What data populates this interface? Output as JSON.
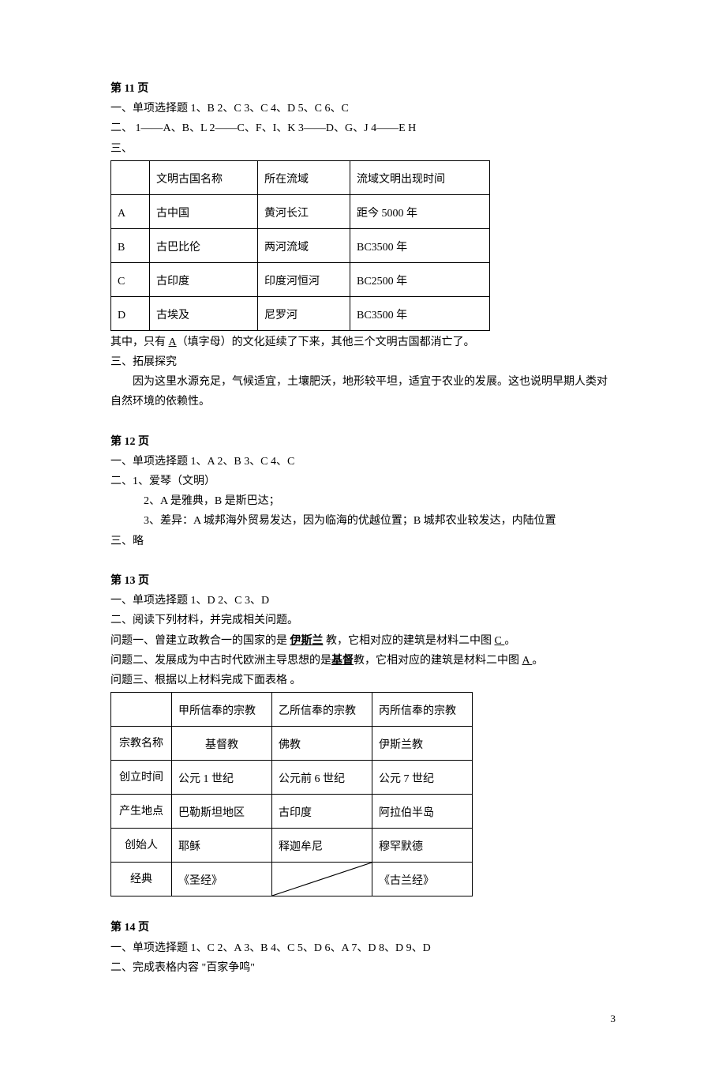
{
  "page11": {
    "heading": "第 11 页",
    "line1_prefix": "一、单项选择题",
    "mc": [
      "1、B",
      "2、C",
      "3、C",
      "4、D",
      "5、C",
      "6、C"
    ],
    "line2_prefix": "二、",
    "match": [
      "1——A、B、L",
      "2——C、F、I、K",
      "3——D、G、J",
      "4——E   H"
    ],
    "line3": "三、",
    "table_headers": [
      "",
      "文明古国名称",
      "所在流域",
      "流域文明出现时间"
    ],
    "table_rows": [
      [
        "A",
        "古中国",
        "黄河长江",
        "距今 5000 年"
      ],
      [
        "B",
        "古巴比伦",
        "两河流域",
        "BC3500 年"
      ],
      [
        "C",
        "古印度",
        "印度河恒河",
        "BC2500 年"
      ],
      [
        "D",
        "古埃及",
        "尼罗河",
        "BC3500 年"
      ]
    ],
    "after_table_1a": "其中，只有 ",
    "after_table_1_fill": "A",
    "after_table_1b": "（填字母）的文化延续了下来，其他三个文明古国都消亡了。",
    "after_table_2": "三、拓展探究",
    "after_table_3": "因为这里水源充足，气候适宜，土壤肥沃，地形较平坦，适宜于农业的发展。这也说明早期人类对自然环境的依赖性。"
  },
  "page12": {
    "heading": "第 12 页",
    "line1_prefix": "一、单项选择题",
    "mc": [
      "1、A",
      "2、B",
      "3、C",
      "4、C"
    ],
    "line2": "二、1、爱琴（文明）",
    "line3": "2、A 是雅典，B 是斯巴达；",
    "line4": "3、差异：A 城邦海外贸易发达，因为临海的优越位置；B 城邦农业较发达，内陆位置",
    "line5": "三、略"
  },
  "page13": {
    "heading": "第 13 页",
    "line1_prefix": "一、单项选择题",
    "mc": [
      "1、D",
      "2、C",
      "3、D"
    ],
    "line2": "二、阅读下列材料，并完成相关问题。",
    "q1a": "问题一、曾建立政教合一的国家的是  ",
    "q1_fill1": "伊斯兰",
    "q1b": "  教，它相对应的建筑是材料二中图 ",
    "q1_fill2": " C    ",
    "q1c": " 。",
    "q2a": "问题二、发展成为中古时代欧洲主导思想的是",
    "q2_fill1": "基督",
    "q2b": "教，它相对应的建筑是材料二中图 ",
    "q2_fill2": " A   ",
    "q2c": " 。",
    "q3": "问题三、根据以上材料完成下面表格  。",
    "table_headers": [
      "",
      "甲所信奉的宗教",
      "乙所信奉的宗教",
      "丙所信奉的宗教"
    ],
    "table_rows": [
      [
        "宗教名称",
        "基督教",
        "佛教",
        "伊斯兰教"
      ],
      [
        "创立时间",
        "公元 1 世纪",
        "公元前 6 世纪",
        "公元 7 世纪"
      ],
      [
        "产生地点",
        "巴勒斯坦地区",
        "古印度",
        "阿拉伯半岛"
      ],
      [
        "创始人",
        "耶稣",
        "释迦牟尼",
        "穆罕默德"
      ],
      [
        "经典",
        "《圣经》",
        "",
        "《古兰经》"
      ]
    ]
  },
  "page14": {
    "heading": "第 14 页",
    "line1_prefix": "一、单项选择题",
    "mc": [
      "1、C",
      "2、A",
      "3、B",
      "4、C",
      "5、D",
      "6、A",
      "7、D",
      "8、D",
      "9、D"
    ],
    "line2": "二、完成表格内容    \"百家争鸣\""
  },
  "footer": "3"
}
